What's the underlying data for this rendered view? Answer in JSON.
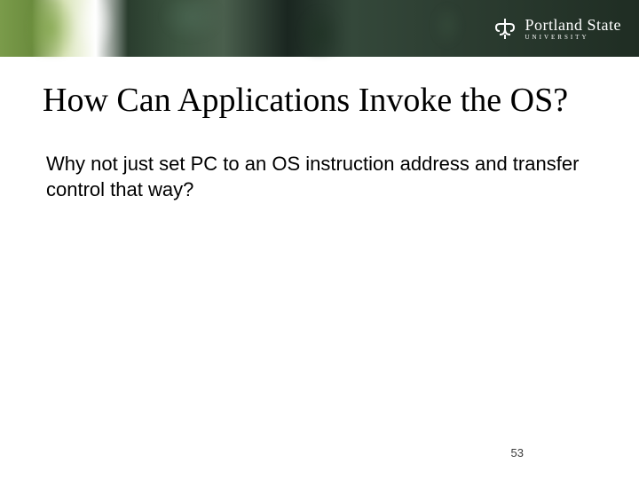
{
  "header": {
    "institution_name": "Portland State",
    "institution_sub": "UNIVERSITY"
  },
  "slide": {
    "title": "How Can Applications Invoke the OS?",
    "body": "Why not just set PC to an OS instruction address and transfer control that way?",
    "page_number": "53"
  }
}
